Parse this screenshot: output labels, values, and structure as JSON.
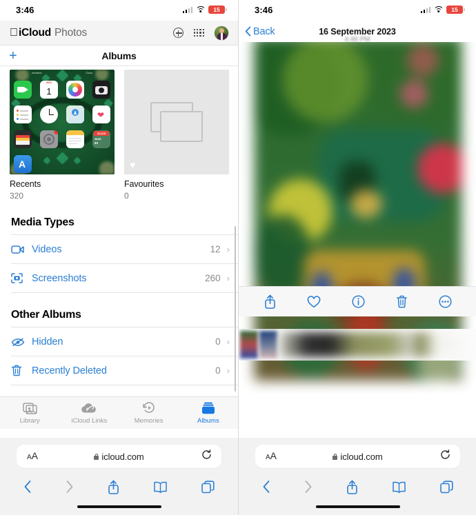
{
  "left_panel": {
    "status_bar": {
      "time": "3:46",
      "battery_level": "15",
      "cellular_icon": "cellular-bars-icon",
      "wifi_icon": "wifi-icon",
      "battery_icon": "battery-low-icon"
    },
    "icloud_header": {
      "apple_logo": "apple-logo-icon",
      "brand": "iCloud",
      "app_name": "Photos",
      "add_icon": "plus-circle-icon",
      "apps_icon": "app-grid-icon",
      "avatar_icon": "user-avatar"
    },
    "nav": {
      "add_label": "+",
      "title": "Albums"
    },
    "albums": [
      {
        "name": "Recents",
        "count": "320",
        "thumb": "home-screen-photo"
      },
      {
        "name": "Favourites",
        "count": "0",
        "thumb": "empty-placeholder-icon",
        "badge_icon": "heart-icon"
      }
    ],
    "media_types": {
      "title": "Media Types",
      "rows": [
        {
          "label": "Videos",
          "count": "12",
          "icon": "video-camera-icon",
          "chevron": "chevron-right-icon"
        },
        {
          "label": "Screenshots",
          "count": "260",
          "icon": "screenshot-icon",
          "chevron": "chevron-right-icon"
        }
      ]
    },
    "other_albums": {
      "title": "Other Albums",
      "rows": [
        {
          "label": "Hidden",
          "count": "0",
          "icon": "eye-slash-icon",
          "chevron": "chevron-right-icon"
        },
        {
          "label": "Recently Deleted",
          "count": "0",
          "icon": "trash-icon",
          "chevron": "chevron-right-icon"
        }
      ]
    },
    "tabbar": [
      {
        "label": "Library",
        "icon": "photo-stack-icon",
        "active": false
      },
      {
        "label": "iCloud Links",
        "icon": "cloud-link-icon",
        "active": false
      },
      {
        "label": "Memories",
        "icon": "memories-clock-icon",
        "active": false
      },
      {
        "label": "Albums",
        "icon": "albums-icon",
        "active": true
      }
    ],
    "safari": {
      "text_size_label": "AA",
      "lock_icon": "lock-icon",
      "url": "icloud.com",
      "reload_icon": "reload-icon",
      "tools": [
        {
          "icon": "back-chevron-icon",
          "enabled": true
        },
        {
          "icon": "forward-chevron-icon",
          "enabled": false
        },
        {
          "icon": "share-icon",
          "enabled": true
        },
        {
          "icon": "bookmarks-icon",
          "enabled": true
        },
        {
          "icon": "tabs-icon",
          "enabled": true
        }
      ]
    }
  },
  "right_panel": {
    "status_bar": {
      "time": "3:46",
      "battery_level": "15",
      "cellular_icon": "cellular-bars-icon",
      "wifi_icon": "wifi-icon",
      "battery_icon": "battery-low-icon"
    },
    "nav": {
      "back_label": "Back",
      "back_icon": "chevron-left-icon",
      "date": "16 September 2023",
      "time": "4:46 PM"
    },
    "viewer": {
      "media_type": "video",
      "play_icon": "play-triangle-icon",
      "filmstrip_label": "photo-filmstrip"
    },
    "tools": [
      {
        "icon": "share-icon"
      },
      {
        "icon": "heart-icon"
      },
      {
        "icon": "info-icon"
      },
      {
        "icon": "trash-icon"
      },
      {
        "icon": "more-ellipsis-icon"
      }
    ],
    "safari": {
      "text_size_label": "AA",
      "lock_icon": "lock-icon",
      "url": "icloud.com",
      "reload_icon": "reload-icon",
      "tools": [
        {
          "icon": "back-chevron-icon",
          "enabled": true
        },
        {
          "icon": "forward-chevron-icon",
          "enabled": false
        },
        {
          "icon": "share-icon",
          "enabled": true
        },
        {
          "icon": "bookmarks-icon",
          "enabled": true
        },
        {
          "icon": "tabs-icon",
          "enabled": true
        }
      ]
    }
  },
  "colors": {
    "accent": "#2b7fd4",
    "tab_active": "#1878e0",
    "battery_low": "#e8453c",
    "muted": "#8a8a8a"
  }
}
